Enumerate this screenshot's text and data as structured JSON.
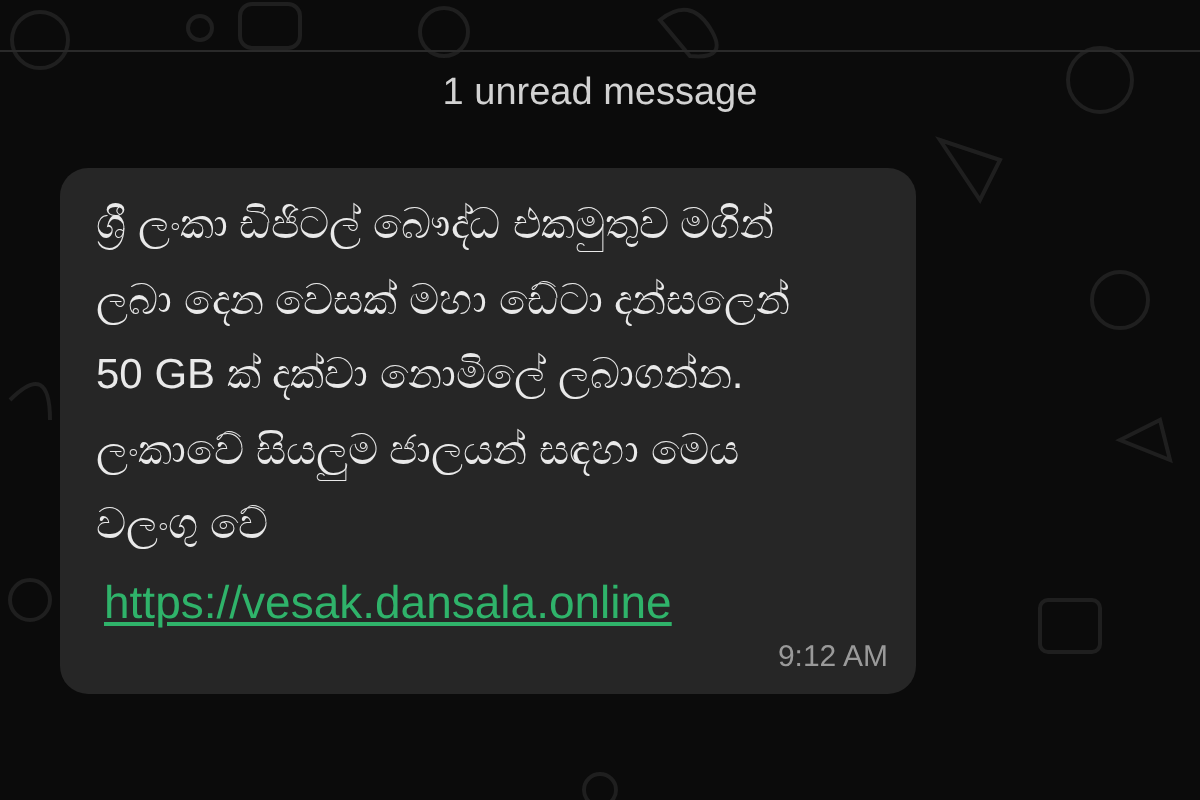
{
  "unread_banner": {
    "text": "1 unread message"
  },
  "message": {
    "text": "ශ්‍රී ලංකා ඩිජිටල් බෞද්ධ එකමුතුව මගින්\nලබා දෙන වෙසක් මහා ඩේටා දන්සලෙන්\n50 GB ක් දක්වා නොමිලේ ලබාගන්න.\nලංකාවේ සියලුම ජාලයන් සඳහා මෙය\nවලංගු වේ",
    "link": "https://vesak.dansala.online",
    "time": "9:12 AM"
  }
}
